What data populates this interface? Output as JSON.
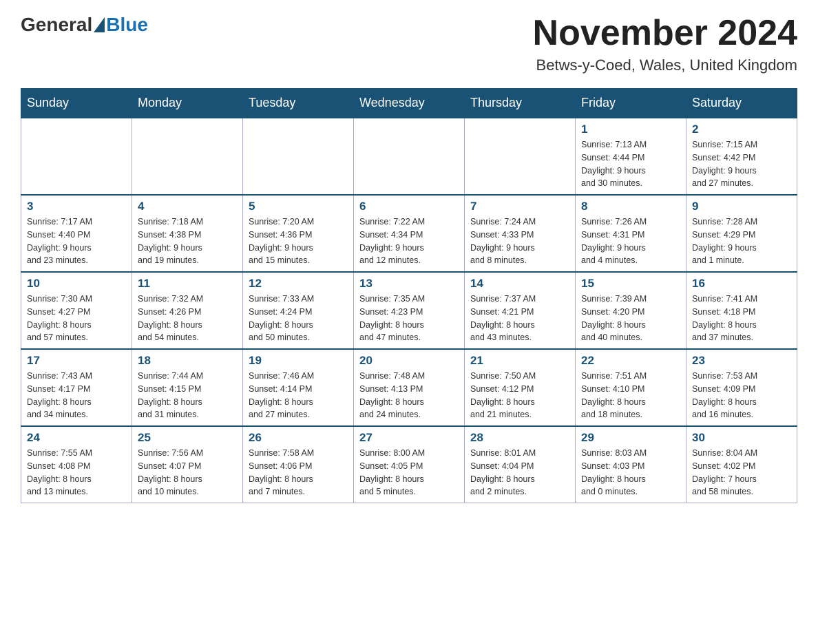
{
  "header": {
    "logo_general": "General",
    "logo_blue": "Blue",
    "month_title": "November 2024",
    "location": "Betws-y-Coed, Wales, United Kingdom"
  },
  "days_of_week": [
    "Sunday",
    "Monday",
    "Tuesday",
    "Wednesday",
    "Thursday",
    "Friday",
    "Saturday"
  ],
  "weeks": [
    [
      {
        "day": "",
        "info": ""
      },
      {
        "day": "",
        "info": ""
      },
      {
        "day": "",
        "info": ""
      },
      {
        "day": "",
        "info": ""
      },
      {
        "day": "",
        "info": ""
      },
      {
        "day": "1",
        "info": "Sunrise: 7:13 AM\nSunset: 4:44 PM\nDaylight: 9 hours\nand 30 minutes."
      },
      {
        "day": "2",
        "info": "Sunrise: 7:15 AM\nSunset: 4:42 PM\nDaylight: 9 hours\nand 27 minutes."
      }
    ],
    [
      {
        "day": "3",
        "info": "Sunrise: 7:17 AM\nSunset: 4:40 PM\nDaylight: 9 hours\nand 23 minutes."
      },
      {
        "day": "4",
        "info": "Sunrise: 7:18 AM\nSunset: 4:38 PM\nDaylight: 9 hours\nand 19 minutes."
      },
      {
        "day": "5",
        "info": "Sunrise: 7:20 AM\nSunset: 4:36 PM\nDaylight: 9 hours\nand 15 minutes."
      },
      {
        "day": "6",
        "info": "Sunrise: 7:22 AM\nSunset: 4:34 PM\nDaylight: 9 hours\nand 12 minutes."
      },
      {
        "day": "7",
        "info": "Sunrise: 7:24 AM\nSunset: 4:33 PM\nDaylight: 9 hours\nand 8 minutes."
      },
      {
        "day": "8",
        "info": "Sunrise: 7:26 AM\nSunset: 4:31 PM\nDaylight: 9 hours\nand 4 minutes."
      },
      {
        "day": "9",
        "info": "Sunrise: 7:28 AM\nSunset: 4:29 PM\nDaylight: 9 hours\nand 1 minute."
      }
    ],
    [
      {
        "day": "10",
        "info": "Sunrise: 7:30 AM\nSunset: 4:27 PM\nDaylight: 8 hours\nand 57 minutes."
      },
      {
        "day": "11",
        "info": "Sunrise: 7:32 AM\nSunset: 4:26 PM\nDaylight: 8 hours\nand 54 minutes."
      },
      {
        "day": "12",
        "info": "Sunrise: 7:33 AM\nSunset: 4:24 PM\nDaylight: 8 hours\nand 50 minutes."
      },
      {
        "day": "13",
        "info": "Sunrise: 7:35 AM\nSunset: 4:23 PM\nDaylight: 8 hours\nand 47 minutes."
      },
      {
        "day": "14",
        "info": "Sunrise: 7:37 AM\nSunset: 4:21 PM\nDaylight: 8 hours\nand 43 minutes."
      },
      {
        "day": "15",
        "info": "Sunrise: 7:39 AM\nSunset: 4:20 PM\nDaylight: 8 hours\nand 40 minutes."
      },
      {
        "day": "16",
        "info": "Sunrise: 7:41 AM\nSunset: 4:18 PM\nDaylight: 8 hours\nand 37 minutes."
      }
    ],
    [
      {
        "day": "17",
        "info": "Sunrise: 7:43 AM\nSunset: 4:17 PM\nDaylight: 8 hours\nand 34 minutes."
      },
      {
        "day": "18",
        "info": "Sunrise: 7:44 AM\nSunset: 4:15 PM\nDaylight: 8 hours\nand 31 minutes."
      },
      {
        "day": "19",
        "info": "Sunrise: 7:46 AM\nSunset: 4:14 PM\nDaylight: 8 hours\nand 27 minutes."
      },
      {
        "day": "20",
        "info": "Sunrise: 7:48 AM\nSunset: 4:13 PM\nDaylight: 8 hours\nand 24 minutes."
      },
      {
        "day": "21",
        "info": "Sunrise: 7:50 AM\nSunset: 4:12 PM\nDaylight: 8 hours\nand 21 minutes."
      },
      {
        "day": "22",
        "info": "Sunrise: 7:51 AM\nSunset: 4:10 PM\nDaylight: 8 hours\nand 18 minutes."
      },
      {
        "day": "23",
        "info": "Sunrise: 7:53 AM\nSunset: 4:09 PM\nDaylight: 8 hours\nand 16 minutes."
      }
    ],
    [
      {
        "day": "24",
        "info": "Sunrise: 7:55 AM\nSunset: 4:08 PM\nDaylight: 8 hours\nand 13 minutes."
      },
      {
        "day": "25",
        "info": "Sunrise: 7:56 AM\nSunset: 4:07 PM\nDaylight: 8 hours\nand 10 minutes."
      },
      {
        "day": "26",
        "info": "Sunrise: 7:58 AM\nSunset: 4:06 PM\nDaylight: 8 hours\nand 7 minutes."
      },
      {
        "day": "27",
        "info": "Sunrise: 8:00 AM\nSunset: 4:05 PM\nDaylight: 8 hours\nand 5 minutes."
      },
      {
        "day": "28",
        "info": "Sunrise: 8:01 AM\nSunset: 4:04 PM\nDaylight: 8 hours\nand 2 minutes."
      },
      {
        "day": "29",
        "info": "Sunrise: 8:03 AM\nSunset: 4:03 PM\nDaylight: 8 hours\nand 0 minutes."
      },
      {
        "day": "30",
        "info": "Sunrise: 8:04 AM\nSunset: 4:02 PM\nDaylight: 7 hours\nand 58 minutes."
      }
    ]
  ]
}
